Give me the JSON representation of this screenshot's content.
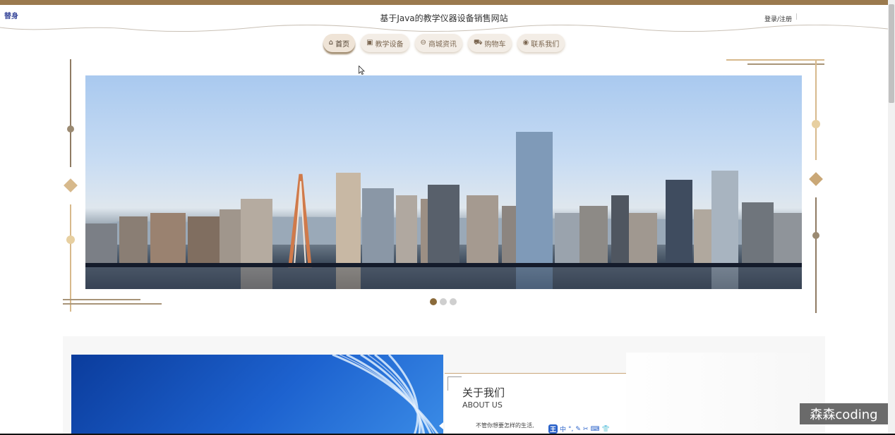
{
  "header": {
    "corner_logo": "替身",
    "site_title": "基于Java的教学仪器设备销售网站",
    "login_label": "登录/注册",
    "separator": "|"
  },
  "nav": {
    "items": [
      {
        "label": "首页",
        "icon": "home-icon",
        "glyph": "⌂",
        "active": true
      },
      {
        "label": "教学设备",
        "icon": "equipment-icon",
        "glyph": "▣",
        "active": false
      },
      {
        "label": "商城资讯",
        "icon": "news-icon",
        "glyph": "⊖",
        "active": false
      },
      {
        "label": "购物车",
        "icon": "cart-icon",
        "glyph": "⛟",
        "active": false
      },
      {
        "label": "联系我们",
        "icon": "contact-icon",
        "glyph": "◉",
        "active": false
      }
    ]
  },
  "carousel": {
    "slide_count": 3,
    "active_index": 0
  },
  "about": {
    "title": "关于我们",
    "subtitle": "ABOUT US",
    "text": "不管你想要怎样的生活,"
  },
  "ime": {
    "badge": "王",
    "mode": "中"
  },
  "watermark": "森森coding",
  "colors": {
    "accent": "#9b7a4e",
    "gold": "#d7b98c",
    "brown_dark": "#8a6a3a",
    "active_dot": "#8a6a3a",
    "nav_bg": "#f3ede6"
  }
}
